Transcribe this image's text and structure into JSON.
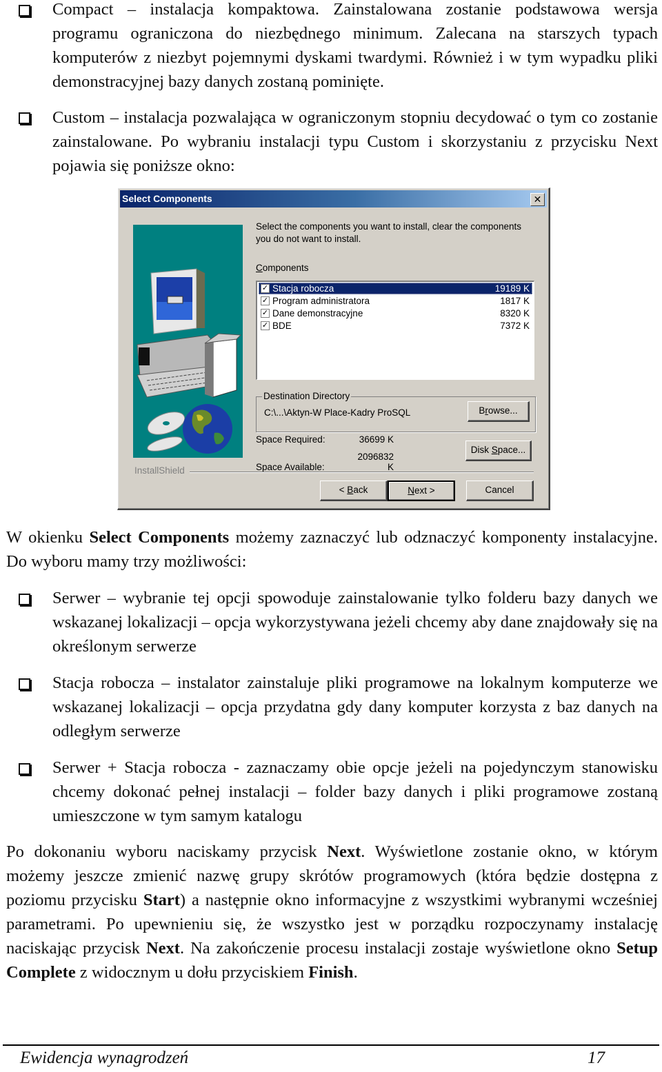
{
  "intro_bullets": [
    {
      "text": "Compact – instalacja kompaktowa. Zainstalowana zostanie podstawowa wersja programu ograniczona do niezbędnego minimum. Zalecana na starszych typach komputerów z niezbyt pojemnymi dyskami twardymi. Również i w tym wypadku pliki demonstracyjnej bazy danych zostaną pominięte."
    },
    {
      "text": "Custom – instalacja pozwalająca w ograniczonym stopniu decydować o tym co zostanie zainstalowane. Po wybraniu instalacji typu Custom i skorzystaniu z przycisku Next pojawia się poniższe okno:"
    }
  ],
  "dialog": {
    "title": "Select Components",
    "close_glyph": "✕",
    "instruction": "Select the components you want to install, clear the components you do not want to install.",
    "components_label_underlined": "C",
    "components_label_rest": "omponents",
    "components": [
      {
        "name": "Stacja robocza",
        "size": "19189 K",
        "checked": true,
        "selected": true
      },
      {
        "name": "Program administratora",
        "size": "1817 K",
        "checked": true,
        "selected": false
      },
      {
        "name": "Dane demonstracyjne",
        "size": "8320 K",
        "checked": true,
        "selected": false
      },
      {
        "name": "BDE",
        "size": "7372 K",
        "checked": true,
        "selected": false
      }
    ],
    "check_glyph": "✓",
    "destination_legend": "Destination Directory",
    "destination_path": "C:\\...\\Aktyn-W Place-Kadry ProSQL",
    "browse_pre": "B",
    "browse_ul": "r",
    "browse_post": "owse...",
    "space_required_label": "Space Required:",
    "space_required_value": "36699 K",
    "space_available_label": "Space Available:",
    "space_available_value": "2096832 K",
    "disk_pre": "Disk ",
    "disk_ul": "S",
    "disk_post": "pace...",
    "installshield_label": "InstallShield",
    "back_pre": "< ",
    "back_ul": "B",
    "back_post": "ack",
    "next_ul": "N",
    "next_post": "ext >",
    "cancel_label": "Cancel",
    "art_colors": {
      "panel": "#008080"
    }
  },
  "select_para": {
    "pre": "W okienku ",
    "bold": "Select Components",
    "post": " możemy zaznaczyć lub odznaczyć komponenty instalacyjne. Do wyboru mamy trzy możliwości:"
  },
  "option_bullets": [
    {
      "text": "Serwer – wybranie tej opcji spowoduje zainstalowanie tylko folderu bazy danych we wskazanej lokalizacji – opcja wykorzystywana jeżeli chcemy aby dane znajdowały się na określonym serwerze"
    },
    {
      "text": "Stacja robocza – instalator zainstaluje pliki programowe na lokalnym komputerze we wskazanej lokalizacji – opcja przydatna gdy dany komputer korzysta z baz danych na odległym serwerze"
    },
    {
      "text": "Serwer + Stacja robocza - zaznaczamy obie opcje jeżeli na pojedynczym stanowisku chcemy dokonać pełnej instalacji – folder bazy danych i pliki programowe zostaną umieszczone w tym samym katalogu"
    }
  ],
  "final_para": {
    "t1": "Po dokonaniu wyboru naciskamy przycisk ",
    "b1": "Next",
    "t2": ". Wyświetlone zostanie okno, w którym możemy jeszcze zmienić nazwę grupy skrótów programowych (która będzie dostępna z poziomu przycisku ",
    "b2": "Start",
    "t3": ") a następnie okno informacyjne z wszystkimi wybranymi wcześniej parametrami. Po upewnieniu się, że wszystko jest w porządku rozpoczynamy instalację naciskając przycisk ",
    "b3": "Next",
    "t4": ". Na zakończenie procesu instalacji zostaje wyświetlone okno ",
    "b4": "Setup Complete",
    "t5": " z widocznym u dołu przyciskiem ",
    "b5": "Finish",
    "t6": "."
  },
  "footer": {
    "title": "Ewidencja wynagrodzeń",
    "page_number": "17"
  }
}
